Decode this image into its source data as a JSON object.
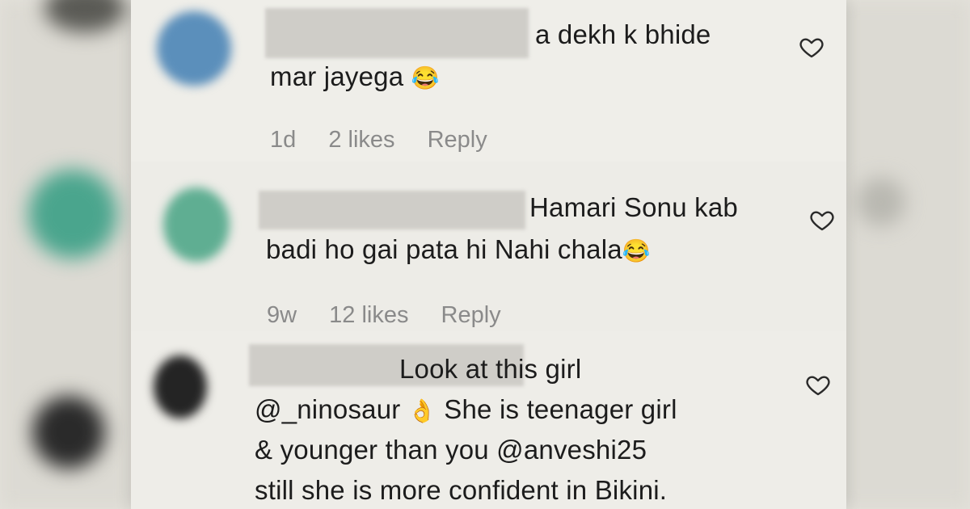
{
  "comments": [
    {
      "line1": "a dekh k bhide",
      "line2": "mar jayega",
      "emoji": "😂",
      "time": "1d",
      "likes": "2 likes",
      "reply": "Reply"
    },
    {
      "line1": "Hamari Sonu kab",
      "line2": "badi ho gai pata hi Nahi chala",
      "emoji": "😂",
      "time": "9w",
      "likes": "12 likes",
      "reply": "Reply"
    },
    {
      "line1": "Look at this girl",
      "line2_mention": "@_ninosaur",
      "line2_emoji": "👌",
      "line2_rest": "She is teenager girl",
      "line3": "& younger than you @anveshi25",
      "line4": "still she is more confident in Bikini."
    }
  ],
  "icons": {
    "like": "heart-outline-icon"
  }
}
